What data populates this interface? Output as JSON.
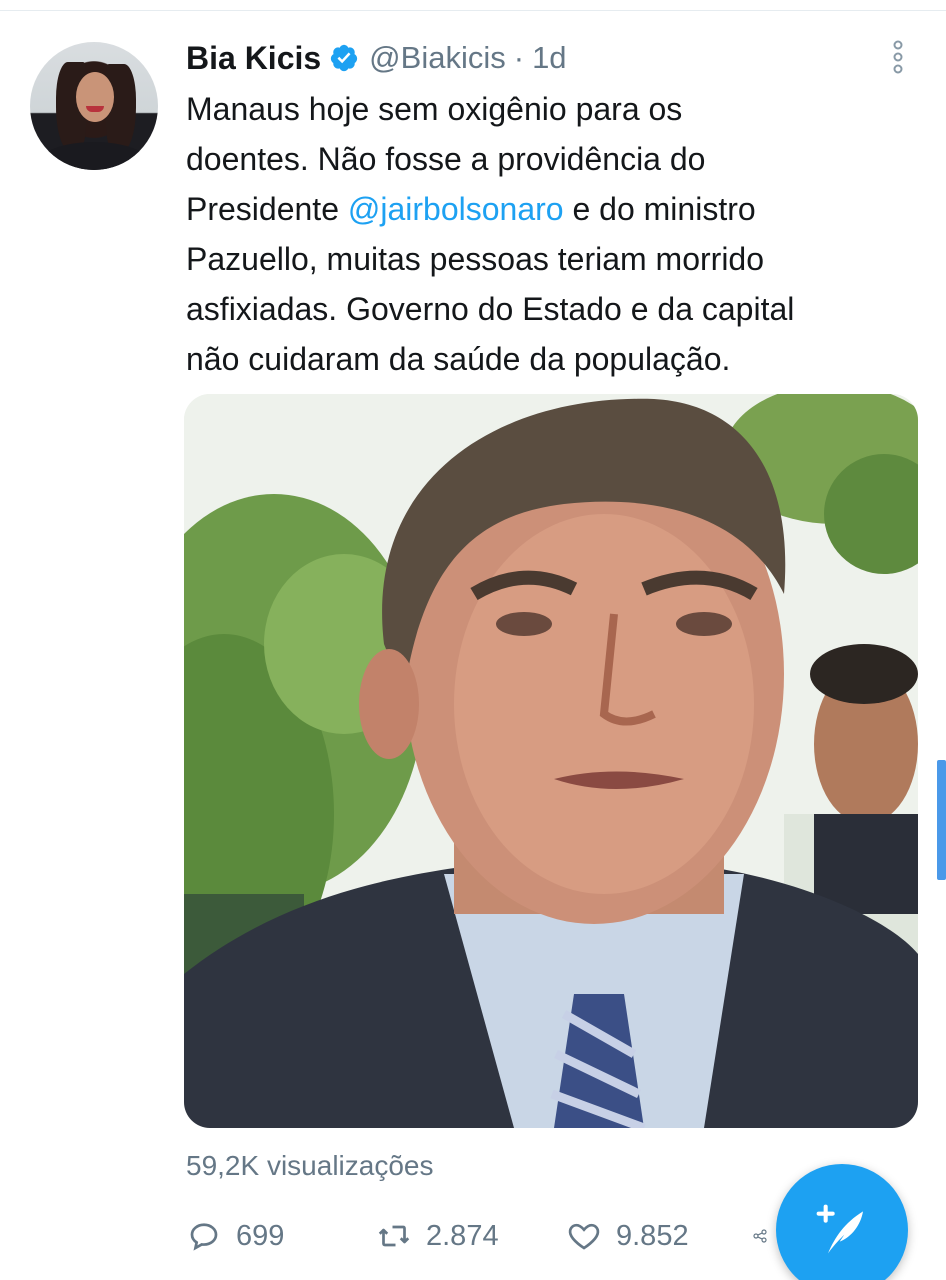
{
  "tweet": {
    "author_name": "Bia Kicis",
    "handle": "@Biakicis",
    "separator": "·",
    "time": "1d",
    "verified": true,
    "text_lines": [
      {
        "before": "Manaus hoje sem oxigênio para os",
        "mention": "",
        "after": ""
      },
      {
        "before": "doentes. Não fosse a providência do",
        "mention": "",
        "after": ""
      },
      {
        "before": "Presidente ",
        "mention": "@jairbolsonaro",
        "after": " e do ministro"
      },
      {
        "before": "Pazuello, muitas pessoas teriam morrido",
        "mention": "",
        "after": ""
      },
      {
        "before": "asfixiadas. Governo do Estado e da capital",
        "mention": "",
        "after": ""
      },
      {
        "before": "não cuidaram da saúde da população.",
        "mention": "",
        "after": ""
      }
    ],
    "views": "59,2K visualizações",
    "replies": "699",
    "retweets": "2.874",
    "likes": "9.852"
  },
  "icons": {
    "more": "more-vertical-icon",
    "reply": "reply-icon",
    "retweet": "retweet-icon",
    "like": "heart-icon",
    "share": "share-icon",
    "compose": "compose-tweet-icon",
    "verified": "verified-badge-icon"
  },
  "colors": {
    "accent": "#1da1f2",
    "secondary_text": "#657786",
    "primary_text": "#14171a"
  }
}
